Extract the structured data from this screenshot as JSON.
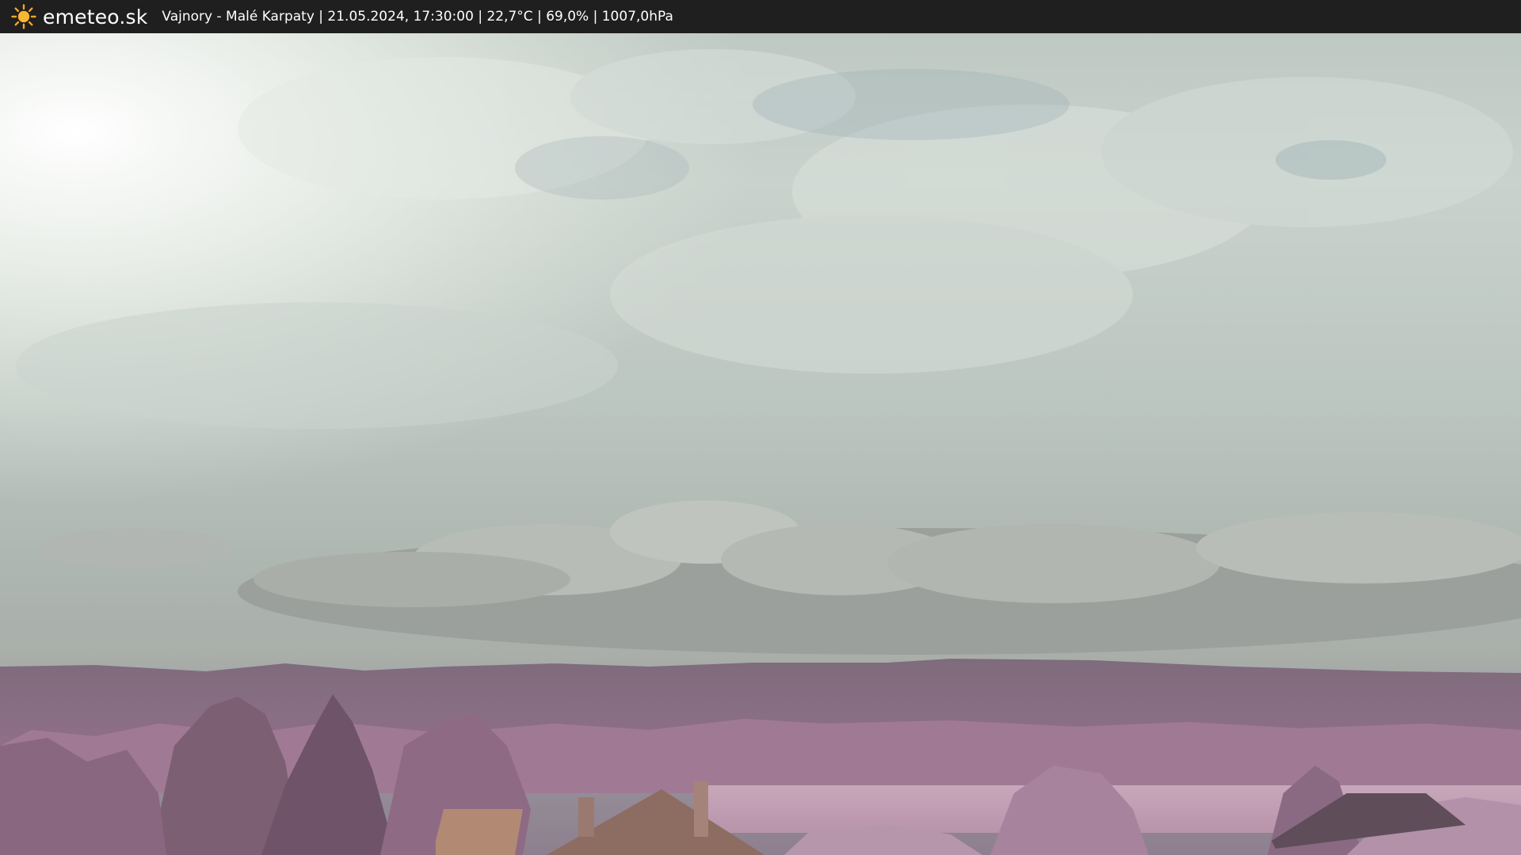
{
  "header": {
    "brand_name": "emeteo.sk",
    "brand_icon": "sun-icon",
    "caption": "Vajnory - Malé Karpaty | 21.05.2024, 17:30:00 | 22,7°C | 69,0% | 1007,0hPa"
  },
  "colors": {
    "bar_background": "#1f1f1f",
    "sun_orange": "#f5a623",
    "sky": "#c4cdc7",
    "foliage_infrared": "#b48ca6"
  }
}
